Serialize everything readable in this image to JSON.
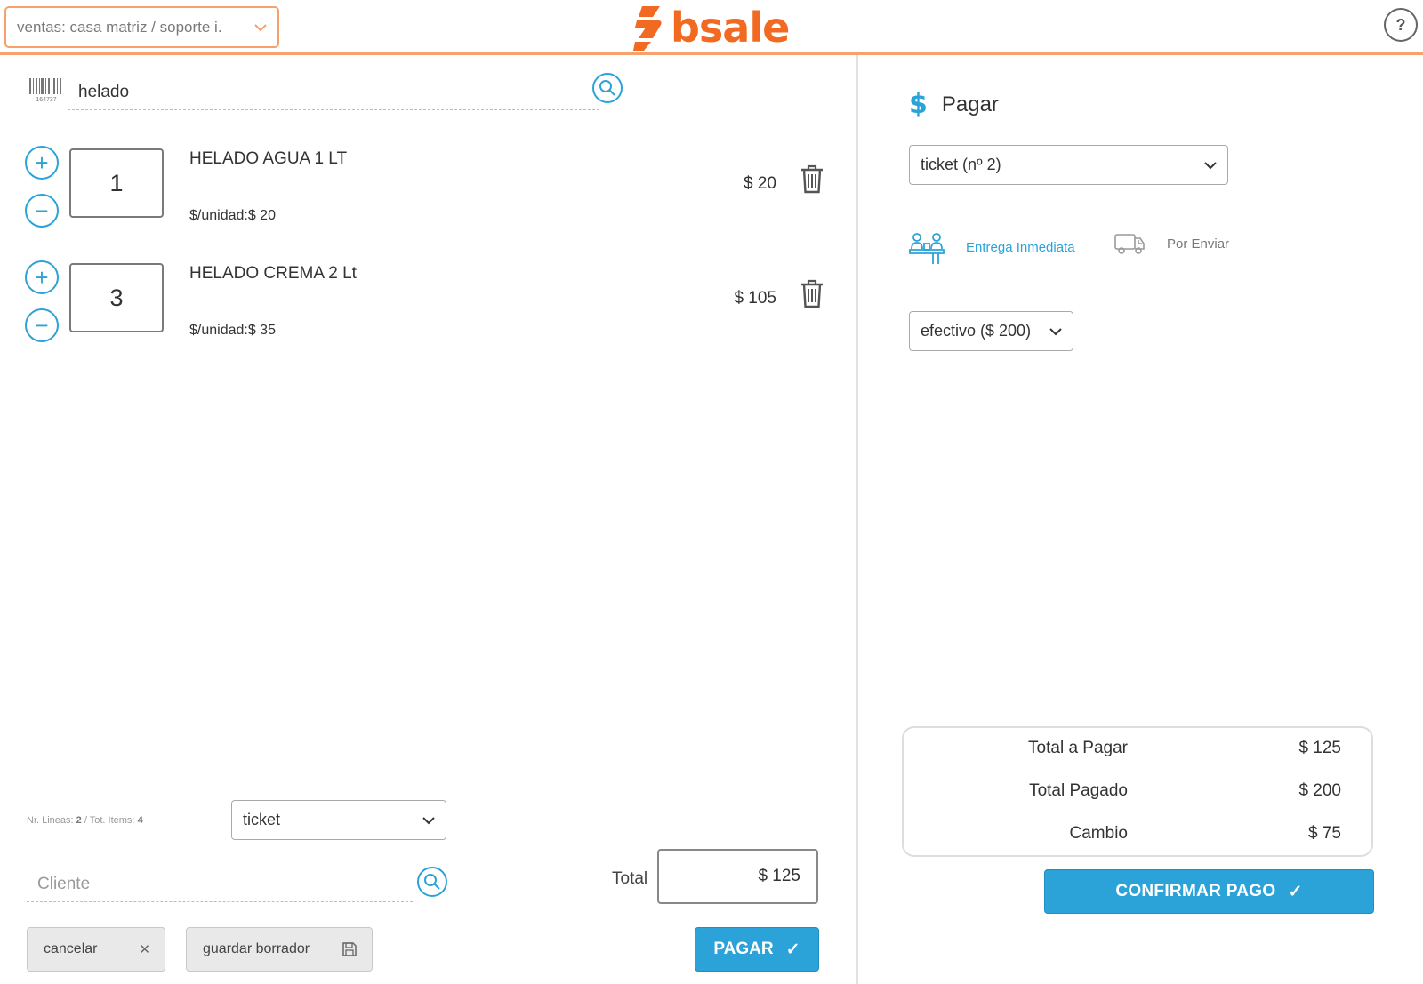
{
  "header": {
    "branch_select": "ventas: casa matriz / soporte i.",
    "logo_text": "bsale",
    "help_label": "?"
  },
  "colors": {
    "brand_orange": "#f26a21",
    "accent_blue": "#2ba3d8",
    "header_border": "#f7a26c"
  },
  "search": {
    "value": "helado",
    "barcode_digits": "164737"
  },
  "items": [
    {
      "qty": "1",
      "name": "HELADO AGUA 1 LT",
      "unit_price": "$/unidad:$ 20",
      "price": "$ 20"
    },
    {
      "qty": "3",
      "name": "HELADO CREMA 2 Lt",
      "unit_price": "$/unidad:$ 35",
      "price": "$ 105"
    }
  ],
  "qty_controls": {
    "plus": "+",
    "minus": "−"
  },
  "footer": {
    "lines_label": "Nr. Lineas:",
    "lines_value": "2",
    "items_label": "/ Tot. Items:",
    "items_value": "4",
    "doc_type": "ticket",
    "client_placeholder": "Cliente",
    "total_label": "Total",
    "total_value": "$ 125",
    "cancel_label": "cancelar",
    "draft_label": "guardar borrador",
    "pay_label": "PAGAR"
  },
  "payment": {
    "title": "Pagar",
    "dollar_symbol": "$",
    "document": "ticket (nº 2)",
    "delivery_immediate": "Entrega Inmediata",
    "delivery_ship": "Por Enviar",
    "method": "efectivo ($ 200)",
    "summary": [
      {
        "label": "Total a Pagar",
        "value": "$ 125"
      },
      {
        "label": "Total Pagado",
        "value": "$ 200"
      },
      {
        "label": "Cambio",
        "value": "$ 75"
      }
    ],
    "confirm_label": "CONFIRMAR PAGO"
  },
  "icons": {
    "check": "✓",
    "close": "✕"
  }
}
